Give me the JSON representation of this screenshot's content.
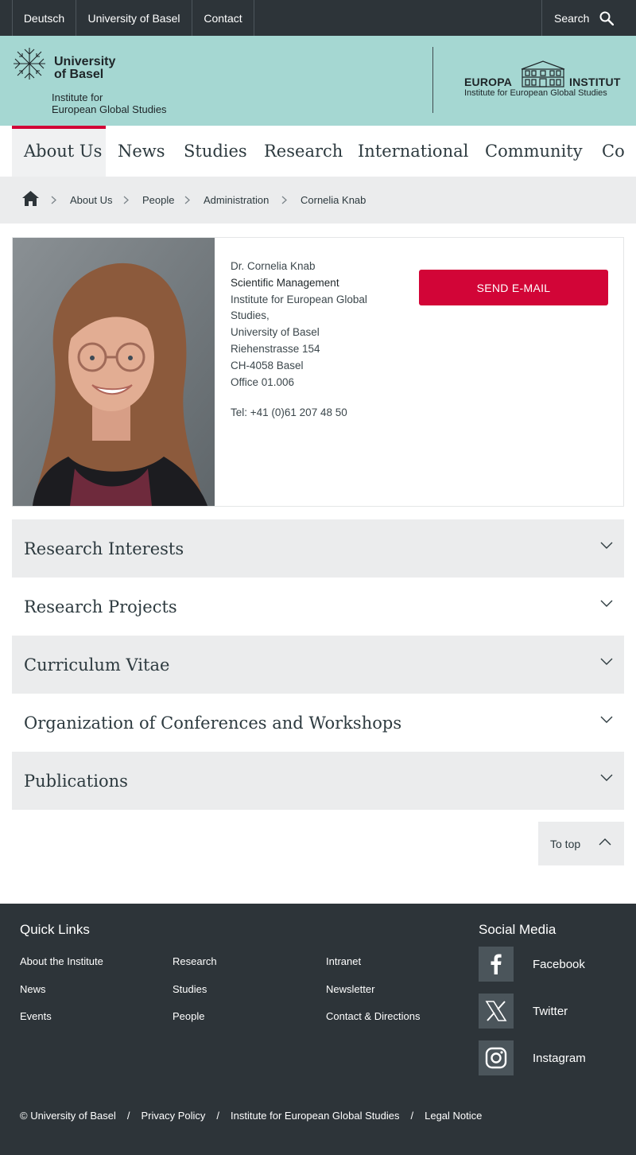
{
  "topbar": {
    "links": [
      "Deutsch",
      "University of Basel",
      "Contact"
    ],
    "search_label": "Search"
  },
  "header": {
    "university_line1": "University",
    "university_line2": "of Basel",
    "institute_line1": "Institute for",
    "institute_line2": "European Global Studies",
    "europa_word1": "EUROPA",
    "europa_word2": "INSTITUT",
    "europa_sub": "Institute for European Global Studies"
  },
  "nav": {
    "items": [
      "About Us",
      "News",
      "Studies",
      "Research",
      "International",
      "Community",
      "Co"
    ],
    "active": "About Us"
  },
  "breadcrumb": {
    "items": [
      "About Us",
      "People",
      "Administration",
      "Cornelia Knab"
    ]
  },
  "person": {
    "name": "Dr. Cornelia Knab",
    "role": "Scientific Management",
    "address_lines": [
      "Institute for European Global",
      "Studies,",
      "University of Basel",
      "Riehenstrasse 154",
      "CH-4058 Basel",
      "Office 01.006"
    ],
    "tel": "Tel: +41 (0)61 207 48 50",
    "email_button": "SEND E-MAIL"
  },
  "accordions": [
    "Research Interests",
    "Research Projects",
    "Curriculum Vitae",
    "Organization of Conferences and Workshops",
    "Publications"
  ],
  "to_top": "To top",
  "footer": {
    "quick_links_title": "Quick Links",
    "quick_links": [
      [
        "About the Institute",
        "Research",
        "Intranet"
      ],
      [
        "News",
        "Studies",
        "Newsletter"
      ],
      [
        "Events",
        "People",
        "Contact & Directions"
      ]
    ],
    "social_title": "Social Media",
    "social": [
      "Facebook",
      "Twitter",
      "Instagram"
    ],
    "legal": [
      "© University of Basel",
      "Privacy Policy",
      "Institute for European Global Studies",
      "Legal Notice"
    ]
  },
  "colors": {
    "accent_red": "#d20537",
    "header_mint": "#a5d7d2",
    "dark": "#2d3439"
  }
}
